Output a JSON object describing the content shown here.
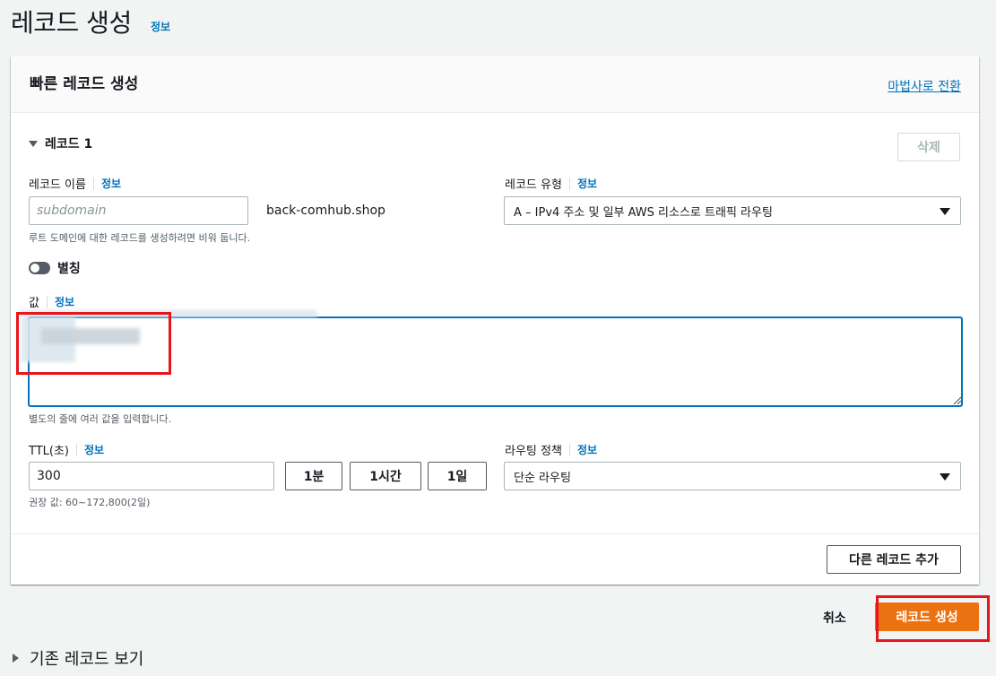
{
  "page": {
    "title": "레코드 생성",
    "info": "정보"
  },
  "panel": {
    "title": "빠른 레코드 생성",
    "wizard_link": "마법사로 전환",
    "record_section": "레코드 1",
    "delete_label": "삭제"
  },
  "record_name": {
    "label": "레코드 이름",
    "info": "정보",
    "placeholder": "subdomain",
    "domain_suffix": "back-comhub.shop",
    "hint": "루트 도메인에 대한 레코드를 생성하려면 비워 둡니다."
  },
  "record_type": {
    "label": "레코드 유형",
    "info": "정보",
    "selected": "A – IPv4 주소 및 일부 AWS 리소스로 트래픽 라우팅"
  },
  "alias": {
    "label": "별칭",
    "enabled": false
  },
  "value": {
    "label": "값",
    "info": "정보",
    "hint": "별도의 줄에 여러 값을 입력합니다."
  },
  "ttl": {
    "label": "TTL(초)",
    "info": "정보",
    "value": "300",
    "presets": [
      "1분",
      "1시간",
      "1일"
    ],
    "hint": "권장 값: 60~172,800(2일)"
  },
  "routing": {
    "label": "라우팅 정책",
    "info": "정보",
    "selected": "단순 라우팅"
  },
  "footer": {
    "add_record": "다른 레코드 추가",
    "cancel": "취소",
    "create": "레코드 생성",
    "existing_records": "기존 레코드 보기"
  },
  "colors": {
    "primary_button": "#ec7211",
    "link": "#0073bb",
    "highlight_box": "#e8151b"
  }
}
